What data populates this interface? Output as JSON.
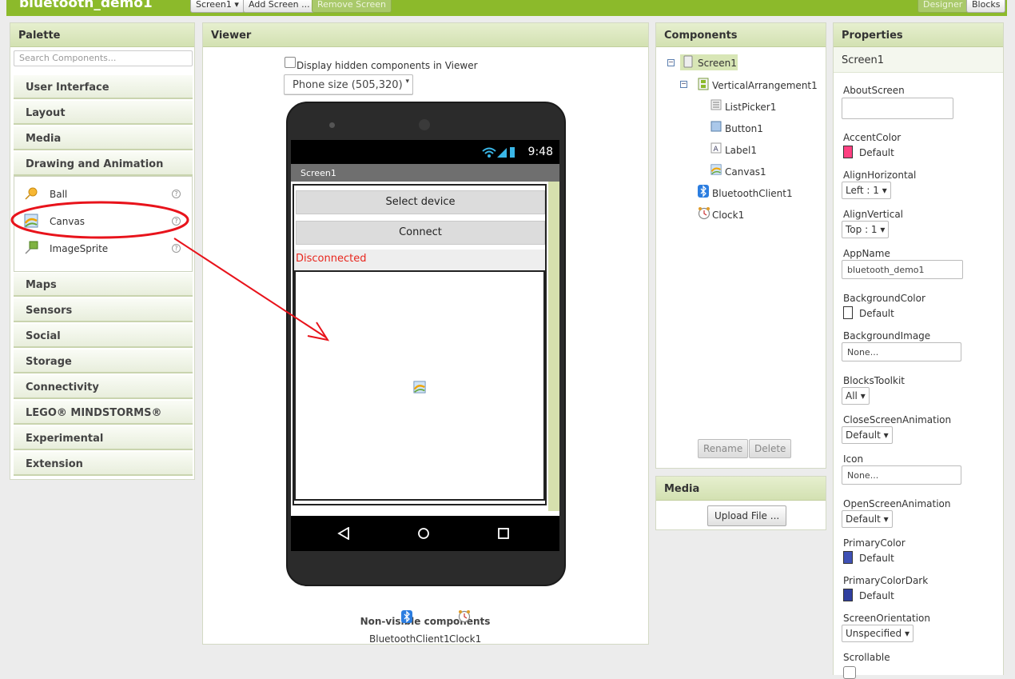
{
  "project_title": "bluetooth_demo1",
  "toolbar": {
    "screen_select": "Screen1 ▾",
    "add_screen": "Add Screen ...",
    "remove_screen": "Remove Screen",
    "designer": "Designer",
    "blocks": "Blocks"
  },
  "palette": {
    "title": "Palette",
    "search_placeholder": "Search Components...",
    "categories_top": [
      "User Interface",
      "Layout",
      "Media",
      "Drawing and Animation"
    ],
    "drawing_items": [
      {
        "label": "Ball",
        "icon": "ball-icon"
      },
      {
        "label": "Canvas",
        "icon": "canvas-icon"
      },
      {
        "label": "ImageSprite",
        "icon": "imagesprite-icon"
      }
    ],
    "help_glyph": "?",
    "categories_bottom": [
      "Maps",
      "Sensors",
      "Social",
      "Storage",
      "Connectivity",
      "LEGO® MINDSTORMS®",
      "Experimental",
      "Extension"
    ]
  },
  "viewer": {
    "title": "Viewer",
    "hidden_label": "Display hidden components in Viewer",
    "phone_size": "Phone size (505,320)",
    "phone": {
      "clock": "9:48",
      "screen_title": "Screen1",
      "listpicker_text": "Select device",
      "button_text": "Connect",
      "label_text": "Disconnected"
    },
    "nonvisible_title": "Non-visible components",
    "nonvisible": [
      {
        "label": "BluetoothClient1",
        "icon": "bluetooth-icon"
      },
      {
        "label": "Clock1",
        "icon": "clock-icon"
      }
    ]
  },
  "components": {
    "title": "Components",
    "tree": [
      {
        "label": "Screen1",
        "icon": "screen-icon",
        "toggle": "−"
      },
      {
        "label": "VerticalArrangement1",
        "icon": "verticalarrangement-icon",
        "toggle": "−"
      },
      {
        "label": "ListPicker1",
        "icon": "listpicker-icon"
      },
      {
        "label": "Button1",
        "icon": "button-icon"
      },
      {
        "label": "Label1",
        "icon": "label-icon"
      },
      {
        "label": "Canvas1",
        "icon": "canvas-icon"
      },
      {
        "label": "BluetoothClient1",
        "icon": "bluetooth-icon"
      },
      {
        "label": "Clock1",
        "icon": "clock-icon"
      }
    ],
    "rename": "Rename",
    "delete": "Delete"
  },
  "media": {
    "title": "Media",
    "upload": "Upload File ..."
  },
  "properties": {
    "title": "Properties",
    "component": "Screen1",
    "about_screen": "AboutScreen",
    "accent_color": "AccentColor",
    "accent_value": "Default",
    "align_h": "AlignHorizontal",
    "align_h_value": "Left : 1 ▾",
    "align_v": "AlignVertical",
    "align_v_value": "Top : 1 ▾",
    "app_name": "AppName",
    "app_name_value": "bluetooth_demo1",
    "bg_color": "BackgroundColor",
    "bg_color_value": "Default",
    "bg_image": "BackgroundImage",
    "bg_image_value": "None...",
    "blocks_toolkit": "BlocksToolkit",
    "blocks_toolkit_value": "All ▾",
    "close_anim": "CloseScreenAnimation",
    "close_anim_value": "Default ▾",
    "icon": "Icon",
    "icon_value": "None...",
    "open_anim": "OpenScreenAnimation",
    "open_anim_value": "Default ▾",
    "primary_color": "PrimaryColor",
    "primary_color_value": "Default",
    "primary_dark": "PrimaryColorDark",
    "primary_dark_value": "Default",
    "orientation": "ScreenOrientation",
    "orientation_value": "Unspecified ▾",
    "scrollable": "Scrollable"
  },
  "colors": {
    "accent": "#ff4081",
    "primary": "#3f51b5",
    "primary_dark": "#303f9f",
    "brand_green": "#8cba2b",
    "annotation_red": "#e8131b"
  }
}
